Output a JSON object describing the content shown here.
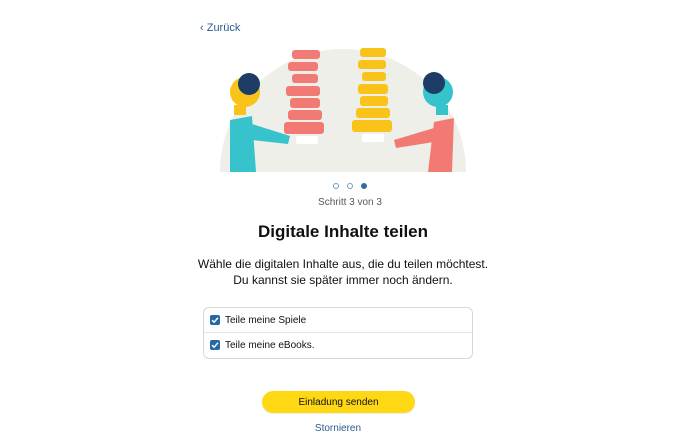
{
  "nav": {
    "back_label": "‹ Zurück"
  },
  "progress": {
    "current_step": 3,
    "total_steps": 3,
    "step_label": "Schritt 3 von 3"
  },
  "content": {
    "title": "Digitale Inhalte teilen",
    "description_line1": "Wähle die digitalen Inhalte aus, die du teilen möchtest.",
    "description_line2": "Du kannst sie später immer noch ändern."
  },
  "options": [
    {
      "label": "Teile meine Spiele",
      "checked": true
    },
    {
      "label": "Teile meine eBooks.",
      "checked": true
    }
  ],
  "actions": {
    "primary_label": "Einladung senden",
    "cancel_label": "Stornieren"
  },
  "colors": {
    "accent_button": "#ffd814",
    "link": "#2a5d8f",
    "checkbox": "#2468a8",
    "book_red": "#f27a74",
    "book_yellow": "#f9c319",
    "person_teal": "#37c3cc"
  }
}
